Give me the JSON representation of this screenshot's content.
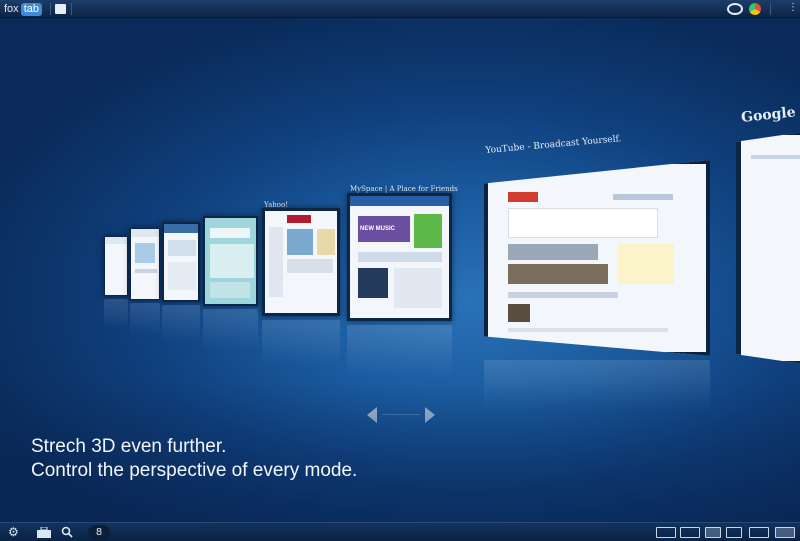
{
  "topbar": {
    "logo_left": "fox",
    "logo_right": "tab"
  },
  "cards": [
    {
      "caption": "",
      "label": "card-1"
    },
    {
      "caption": "",
      "label": "card-2"
    },
    {
      "caption": "",
      "label": "card-3"
    },
    {
      "caption": "",
      "label": "card-4"
    },
    {
      "caption": "Yahoo!",
      "label": "card-yahoo"
    },
    {
      "caption": "MySpace | A Place for Friends",
      "label": "card-myspace",
      "promo": "NEW MUSIC"
    },
    {
      "caption": "YouTube - Broadcast Yourself.",
      "label": "card-youtube"
    },
    {
      "caption": "Google",
      "label": "card-google"
    }
  ],
  "message": {
    "line1": "Strech 3D even further.",
    "line2": "Control the perspective of every mode."
  },
  "bottombar": {
    "count": "8"
  },
  "colors": {
    "background": "#1a5a9e",
    "accent": "#3f8ad6"
  },
  "icons": [
    "gear-icon",
    "toolbox-icon",
    "search-icon",
    "layout-icons"
  ]
}
